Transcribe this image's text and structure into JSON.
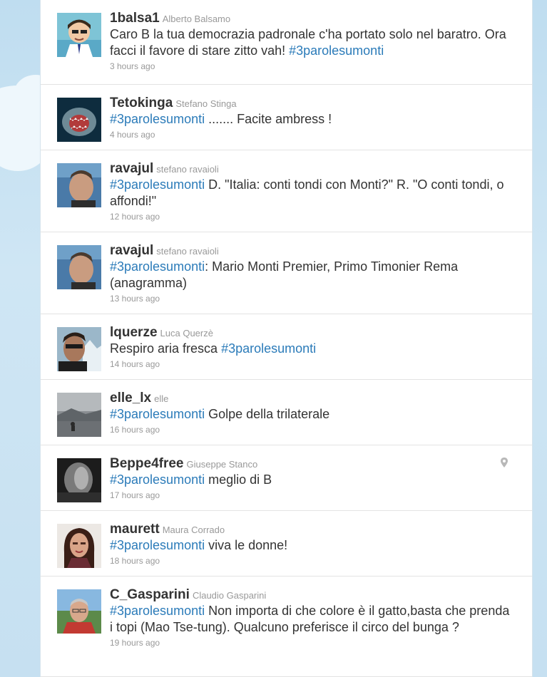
{
  "tweets": [
    {
      "screen_name": "1balsa1",
      "full_name": "Alberto Balsamo",
      "pre": "Caro B la tua democrazia padronale c'ha portato solo nel baratro. Ora facci il favore di stare zitto vah! ",
      "hashtag": "#3parolesumonti",
      "post": "",
      "time": "3 hours ago"
    },
    {
      "screen_name": "Tetokinga",
      "full_name": "Stefano Stinga",
      "pre": "",
      "hashtag": "#3parolesumonti",
      "post": " ....... Facite ambress !",
      "time": "4 hours ago"
    },
    {
      "screen_name": "ravajul",
      "full_name": "stefano ravaioli",
      "pre": "",
      "hashtag": "#3parolesumonti",
      "post": " D. \"Italia: conti tondi con Monti?\" R. \"O conti tondi, o affondi!\"",
      "time": "12 hours ago"
    },
    {
      "screen_name": "ravajul",
      "full_name": "stefano ravaioli",
      "pre": "",
      "hashtag": "#3parolesumonti",
      "post": ": Mario Monti Premier, Primo Timonier Rema (anagramma)",
      "time": "13 hours ago"
    },
    {
      "screen_name": "lquerze",
      "full_name": "Luca Querzè",
      "pre": "Respiro aria fresca ",
      "hashtag": "#3parolesumonti",
      "post": "",
      "time": "14 hours ago"
    },
    {
      "screen_name": "elle_lx",
      "full_name": "elle",
      "pre": "",
      "hashtag": "#3parolesumonti",
      "post": " Golpe della trilaterale",
      "time": "16 hours ago"
    },
    {
      "screen_name": "Beppe4free",
      "full_name": "Giuseppe Stanco",
      "pre": "",
      "hashtag": "#3parolesumonti",
      "post": " meglio di B",
      "time": "17 hours ago"
    },
    {
      "screen_name": "maurett",
      "full_name": "Maura Corrado",
      "pre": "",
      "hashtag": "#3parolesumonti",
      "post": " viva le donne!",
      "time": "18 hours ago"
    },
    {
      "screen_name": "C_Gasparini",
      "full_name": "Claudio Gasparini",
      "pre": "",
      "hashtag": "#3parolesumonti",
      "post": " Non importa di che colore è il gatto,basta che prenda i topi (Mao Tse-tung). Qualcuno preferisce il circo del bunga ?",
      "time": "19 hours ago"
    }
  ],
  "colors": {
    "hashtag": "#2b7bb9",
    "text": "#333333",
    "meta": "#999999",
    "background": "#c6e0f1"
  },
  "icons": {
    "geo_pin": "location-pin-icon"
  }
}
